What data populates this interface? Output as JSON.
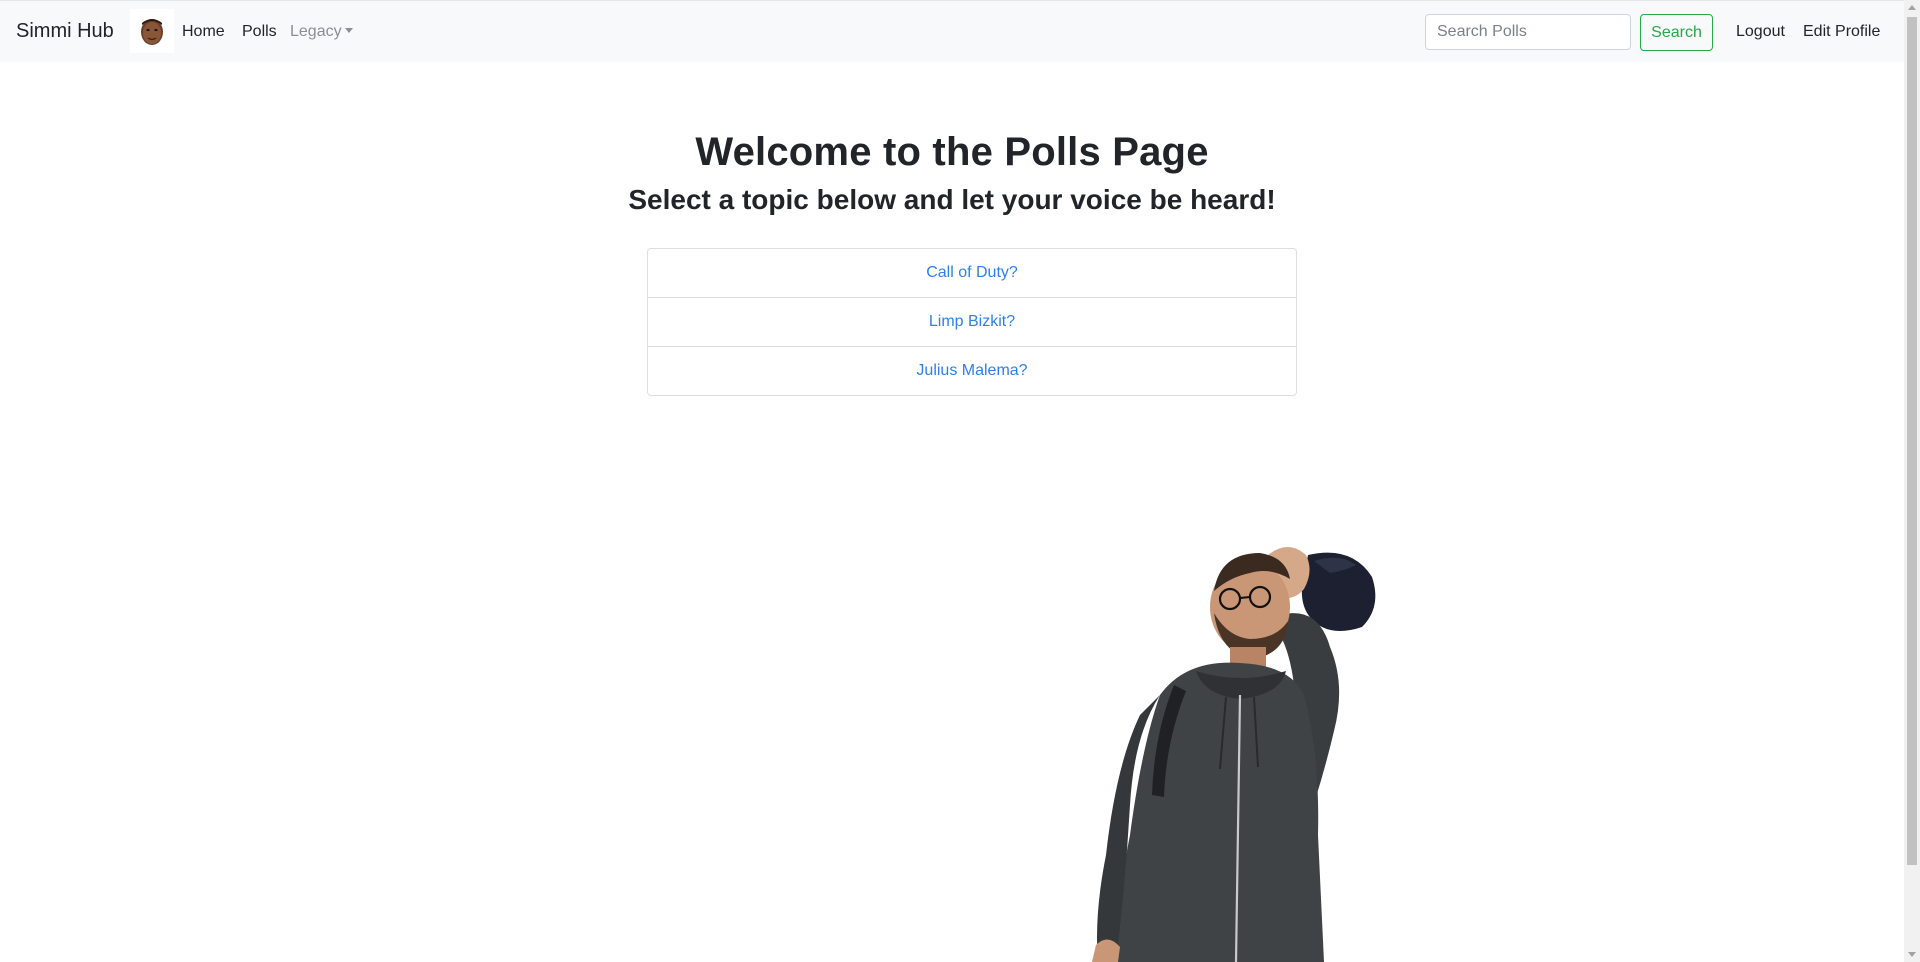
{
  "navbar": {
    "brand": "Simmi Hub",
    "links": {
      "home": "Home",
      "polls": "Polls",
      "legacy": "Legacy"
    },
    "search": {
      "placeholder": "Search Polls",
      "value": "",
      "button_label": "Search"
    },
    "right_links": {
      "logout": "Logout",
      "edit_profile": "Edit Profile"
    }
  },
  "main": {
    "title": "Welcome to the Polls Page",
    "subtitle": "Select a topic below and let your voice be heard!",
    "topics": [
      "Call of Duty?",
      "Limp Bizkit?",
      "Julius Malema?"
    ]
  },
  "colors": {
    "navbar_bg": "#f8f9fa",
    "link_blue": "#2f7fe8",
    "success_green": "#28a745"
  }
}
